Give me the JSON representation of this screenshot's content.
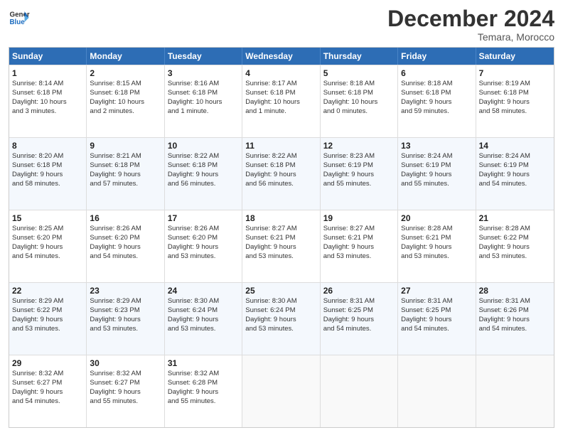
{
  "header": {
    "logo_line1": "General",
    "logo_line2": "Blue",
    "month_title": "December 2024",
    "subtitle": "Temara, Morocco"
  },
  "weekdays": [
    "Sunday",
    "Monday",
    "Tuesday",
    "Wednesday",
    "Thursday",
    "Friday",
    "Saturday"
  ],
  "rows": [
    [
      {
        "day": "1",
        "lines": [
          "Sunrise: 8:14 AM",
          "Sunset: 6:18 PM",
          "Daylight: 10 hours",
          "and 3 minutes."
        ]
      },
      {
        "day": "2",
        "lines": [
          "Sunrise: 8:15 AM",
          "Sunset: 6:18 PM",
          "Daylight: 10 hours",
          "and 2 minutes."
        ]
      },
      {
        "day": "3",
        "lines": [
          "Sunrise: 8:16 AM",
          "Sunset: 6:18 PM",
          "Daylight: 10 hours",
          "and 1 minute."
        ]
      },
      {
        "day": "4",
        "lines": [
          "Sunrise: 8:17 AM",
          "Sunset: 6:18 PM",
          "Daylight: 10 hours",
          "and 1 minute."
        ]
      },
      {
        "day": "5",
        "lines": [
          "Sunrise: 8:18 AM",
          "Sunset: 6:18 PM",
          "Daylight: 10 hours",
          "and 0 minutes."
        ]
      },
      {
        "day": "6",
        "lines": [
          "Sunrise: 8:18 AM",
          "Sunset: 6:18 PM",
          "Daylight: 9 hours",
          "and 59 minutes."
        ]
      },
      {
        "day": "7",
        "lines": [
          "Sunrise: 8:19 AM",
          "Sunset: 6:18 PM",
          "Daylight: 9 hours",
          "and 58 minutes."
        ]
      }
    ],
    [
      {
        "day": "8",
        "lines": [
          "Sunrise: 8:20 AM",
          "Sunset: 6:18 PM",
          "Daylight: 9 hours",
          "and 58 minutes."
        ]
      },
      {
        "day": "9",
        "lines": [
          "Sunrise: 8:21 AM",
          "Sunset: 6:18 PM",
          "Daylight: 9 hours",
          "and 57 minutes."
        ]
      },
      {
        "day": "10",
        "lines": [
          "Sunrise: 8:22 AM",
          "Sunset: 6:18 PM",
          "Daylight: 9 hours",
          "and 56 minutes."
        ]
      },
      {
        "day": "11",
        "lines": [
          "Sunrise: 8:22 AM",
          "Sunset: 6:18 PM",
          "Daylight: 9 hours",
          "and 56 minutes."
        ]
      },
      {
        "day": "12",
        "lines": [
          "Sunrise: 8:23 AM",
          "Sunset: 6:19 PM",
          "Daylight: 9 hours",
          "and 55 minutes."
        ]
      },
      {
        "day": "13",
        "lines": [
          "Sunrise: 8:24 AM",
          "Sunset: 6:19 PM",
          "Daylight: 9 hours",
          "and 55 minutes."
        ]
      },
      {
        "day": "14",
        "lines": [
          "Sunrise: 8:24 AM",
          "Sunset: 6:19 PM",
          "Daylight: 9 hours",
          "and 54 minutes."
        ]
      }
    ],
    [
      {
        "day": "15",
        "lines": [
          "Sunrise: 8:25 AM",
          "Sunset: 6:20 PM",
          "Daylight: 9 hours",
          "and 54 minutes."
        ]
      },
      {
        "day": "16",
        "lines": [
          "Sunrise: 8:26 AM",
          "Sunset: 6:20 PM",
          "Daylight: 9 hours",
          "and 54 minutes."
        ]
      },
      {
        "day": "17",
        "lines": [
          "Sunrise: 8:26 AM",
          "Sunset: 6:20 PM",
          "Daylight: 9 hours",
          "and 53 minutes."
        ]
      },
      {
        "day": "18",
        "lines": [
          "Sunrise: 8:27 AM",
          "Sunset: 6:21 PM",
          "Daylight: 9 hours",
          "and 53 minutes."
        ]
      },
      {
        "day": "19",
        "lines": [
          "Sunrise: 8:27 AM",
          "Sunset: 6:21 PM",
          "Daylight: 9 hours",
          "and 53 minutes."
        ]
      },
      {
        "day": "20",
        "lines": [
          "Sunrise: 8:28 AM",
          "Sunset: 6:21 PM",
          "Daylight: 9 hours",
          "and 53 minutes."
        ]
      },
      {
        "day": "21",
        "lines": [
          "Sunrise: 8:28 AM",
          "Sunset: 6:22 PM",
          "Daylight: 9 hours",
          "and 53 minutes."
        ]
      }
    ],
    [
      {
        "day": "22",
        "lines": [
          "Sunrise: 8:29 AM",
          "Sunset: 6:22 PM",
          "Daylight: 9 hours",
          "and 53 minutes."
        ]
      },
      {
        "day": "23",
        "lines": [
          "Sunrise: 8:29 AM",
          "Sunset: 6:23 PM",
          "Daylight: 9 hours",
          "and 53 minutes."
        ]
      },
      {
        "day": "24",
        "lines": [
          "Sunrise: 8:30 AM",
          "Sunset: 6:24 PM",
          "Daylight: 9 hours",
          "and 53 minutes."
        ]
      },
      {
        "day": "25",
        "lines": [
          "Sunrise: 8:30 AM",
          "Sunset: 6:24 PM",
          "Daylight: 9 hours",
          "and 53 minutes."
        ]
      },
      {
        "day": "26",
        "lines": [
          "Sunrise: 8:31 AM",
          "Sunset: 6:25 PM",
          "Daylight: 9 hours",
          "and 54 minutes."
        ]
      },
      {
        "day": "27",
        "lines": [
          "Sunrise: 8:31 AM",
          "Sunset: 6:25 PM",
          "Daylight: 9 hours",
          "and 54 minutes."
        ]
      },
      {
        "day": "28",
        "lines": [
          "Sunrise: 8:31 AM",
          "Sunset: 6:26 PM",
          "Daylight: 9 hours",
          "and 54 minutes."
        ]
      }
    ],
    [
      {
        "day": "29",
        "lines": [
          "Sunrise: 8:32 AM",
          "Sunset: 6:27 PM",
          "Daylight: 9 hours",
          "and 54 minutes."
        ]
      },
      {
        "day": "30",
        "lines": [
          "Sunrise: 8:32 AM",
          "Sunset: 6:27 PM",
          "Daylight: 9 hours",
          "and 55 minutes."
        ]
      },
      {
        "day": "31",
        "lines": [
          "Sunrise: 8:32 AM",
          "Sunset: 6:28 PM",
          "Daylight: 9 hours",
          "and 55 minutes."
        ]
      },
      {
        "day": "",
        "lines": []
      },
      {
        "day": "",
        "lines": []
      },
      {
        "day": "",
        "lines": []
      },
      {
        "day": "",
        "lines": []
      }
    ]
  ]
}
